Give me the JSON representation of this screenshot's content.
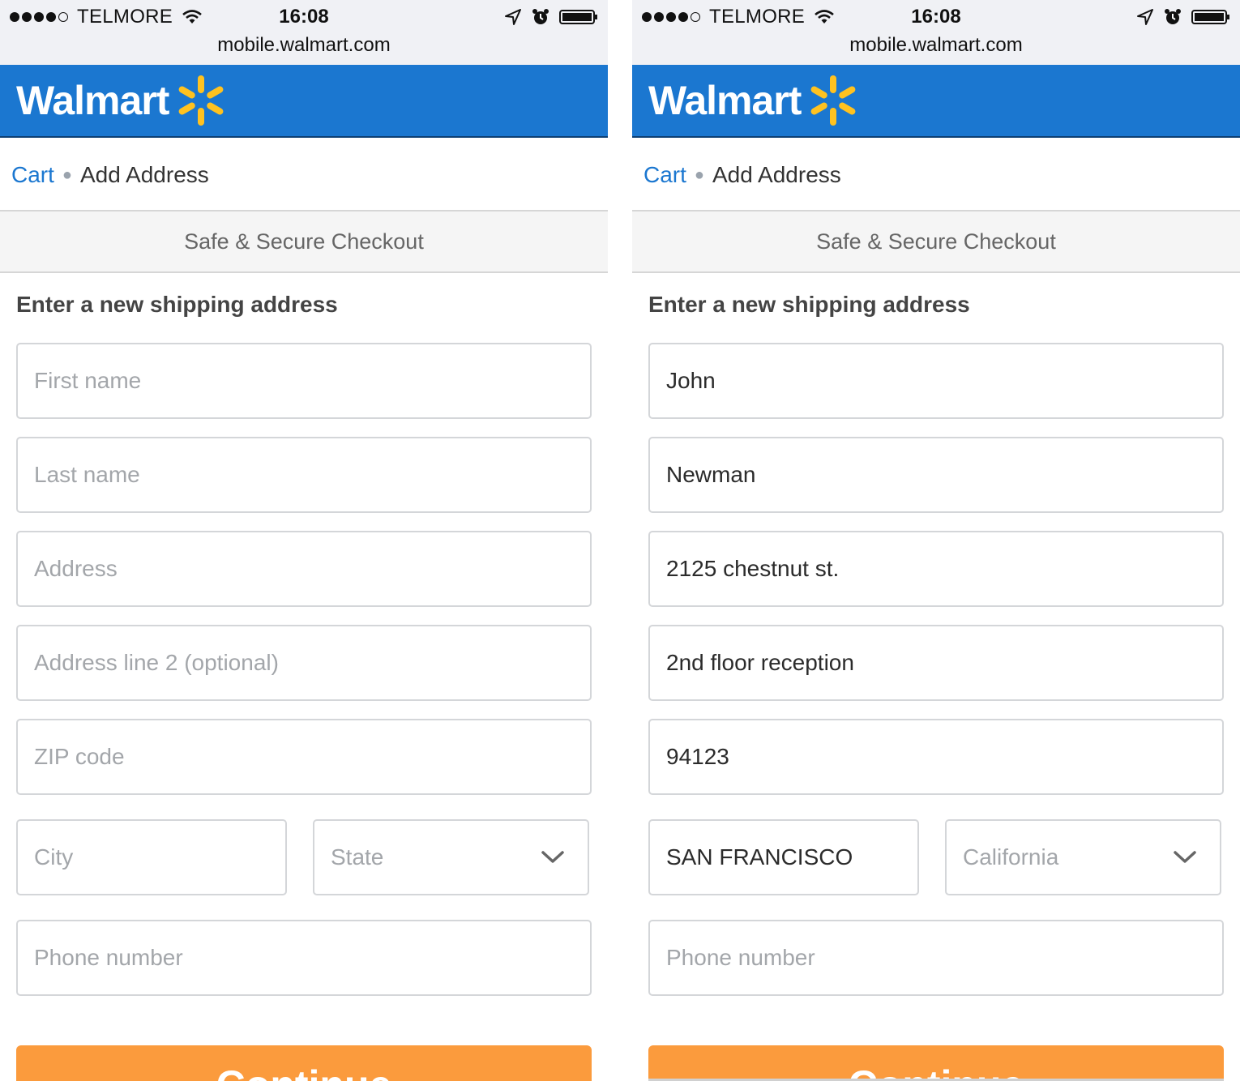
{
  "status_bar": {
    "carrier": "TELMORE",
    "time": "16:08",
    "url": "mobile.walmart.com"
  },
  "header": {
    "logo_text": "Walmart"
  },
  "breadcrumb": {
    "cart": "Cart",
    "current": "Add Address"
  },
  "secure_banner": "Safe & Secure Checkout",
  "form_title": "Enter a new shipping address",
  "continue_label": "Continue",
  "colors": {
    "brand_blue": "#1b77d0",
    "spark_yellow": "#ffc220",
    "continue_orange": "#fb9b3d",
    "link_blue": "#1b77d0"
  },
  "screens": [
    {
      "fields": {
        "first_name": {
          "placeholder": "First name",
          "value": ""
        },
        "last_name": {
          "placeholder": "Last name",
          "value": ""
        },
        "address": {
          "placeholder": "Address",
          "value": ""
        },
        "address2": {
          "placeholder": "Address line 2 (optional)",
          "value": ""
        },
        "zip": {
          "placeholder": "ZIP code",
          "value": ""
        },
        "city": {
          "placeholder": "City",
          "value": ""
        },
        "state": {
          "placeholder": "State",
          "value": ""
        },
        "phone": {
          "placeholder": "Phone number",
          "value": ""
        }
      }
    },
    {
      "fields": {
        "first_name": {
          "placeholder": "First name",
          "value": "John"
        },
        "last_name": {
          "placeholder": "Last name",
          "value": "Newman"
        },
        "address": {
          "placeholder": "Address",
          "value": "2125 chestnut st."
        },
        "address2": {
          "placeholder": "Address line 2 (optional)",
          "value": "2nd floor reception"
        },
        "zip": {
          "placeholder": "ZIP code",
          "value": "94123"
        },
        "city": {
          "placeholder": "City",
          "value": "SAN FRANCISCO"
        },
        "state": {
          "placeholder": "State",
          "value": "California"
        },
        "phone": {
          "placeholder": "Phone number",
          "value": ""
        }
      }
    }
  ]
}
